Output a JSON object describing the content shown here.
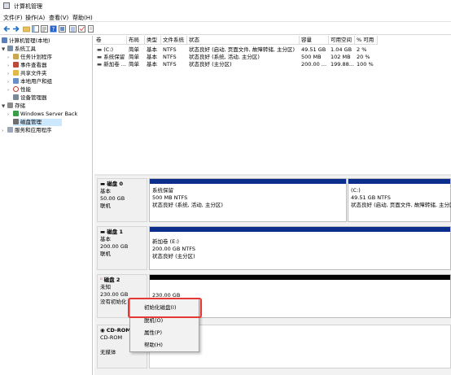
{
  "window": {
    "title": "计算机管理"
  },
  "menu": {
    "file": "文件(F)",
    "action": "操作(A)",
    "view": "查看(V)",
    "help": "帮助(H)"
  },
  "tree": {
    "root": "计算机管理(本地)",
    "system_tools": "系统工具",
    "task_scheduler": "任务计划程序",
    "event_viewer": "事件查看器",
    "shared_folders": "共享文件夹",
    "local_users": "本地用户和组",
    "performance": "性能",
    "device_manager": "设备管理器",
    "storage": "存储",
    "backup": "Windows Server Back",
    "disk_management": "磁盘管理",
    "services_apps": "服务和应用程序"
  },
  "volumes": {
    "headers": [
      "卷",
      "布局",
      "类型",
      "文件系统",
      "状态",
      "容量",
      "可用空间",
      "% 可用"
    ],
    "rows": [
      [
        "(C:)",
        "简单",
        "基本",
        "NTFS",
        "状态良好 (启动, 页面文件, 故障转储, 主分区)",
        "49.51 GB",
        "1.04 GB",
        "2 %"
      ],
      [
        "系统保留",
        "简单",
        "基本",
        "NTFS",
        "状态良好 (系统, 活动, 主分区)",
        "500 MB",
        "102 MB",
        "20 %"
      ],
      [
        "新加卷 ...",
        "简单",
        "基本",
        "NTFS",
        "状态良好 (主分区)",
        "200.00 ...",
        "199.88...",
        "100 %"
      ]
    ]
  },
  "disks": {
    "disk0": {
      "name": "磁盘 0",
      "type": "基本",
      "size": "50.00 GB",
      "status": "联机",
      "p1": {
        "name": "系统保留",
        "size": "500 MB NTFS",
        "status": "状态良好 (系统, 活动, 主分区)"
      },
      "p2": {
        "name": "(C:)",
        "size": "49.51 GB NTFS",
        "status": "状态良好 (启动, 页面文件, 故障转储, 主分区)"
      }
    },
    "disk1": {
      "name": "磁盘 1",
      "type": "基本",
      "size": "200.00 GB",
      "status": "联机",
      "p1": {
        "name": "新加卷 (E:)",
        "size": "200.00 GB NTFS",
        "status": "状态良好 (主分区)"
      }
    },
    "disk2": {
      "name": "磁盘 2",
      "type": "未知",
      "size": "230.00 GB",
      "status": "没有初始化",
      "p1": {
        "size": "230.00 GB"
      }
    },
    "cdrom": {
      "name": "CD-ROM",
      "type": "CD-ROM",
      "status": "无媒体"
    }
  },
  "context_menu": {
    "init": "初始化磁盘(I)",
    "offline": "脱机(O)",
    "properties": "属性(P)",
    "help": "帮助(H)"
  },
  "colors": {
    "partition_bar": "#0b2d8c",
    "unallocated_bar": "#000000",
    "highlight": "#e53935"
  }
}
